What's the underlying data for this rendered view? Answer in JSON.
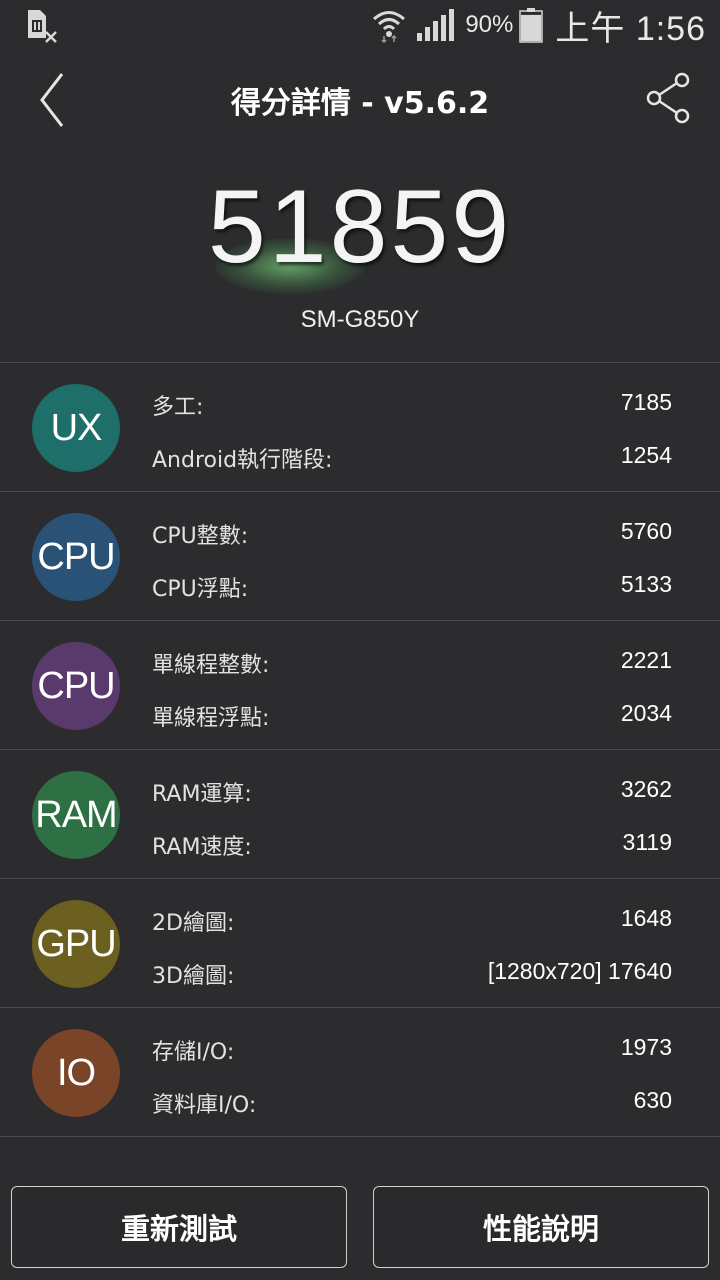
{
  "status_bar": {
    "sim_icon": "no-sim-icon",
    "wifi_icon": "wifi-icon",
    "signal_icon": "signal-icon",
    "battery_percent": "90%",
    "battery_level": 0.9,
    "battery_icon": "battery-icon",
    "time": "上午 1:56"
  },
  "header": {
    "title": "得分詳情 - v5.6.2",
    "back_icon": "back-chevron-icon",
    "share_icon": "share-icon"
  },
  "score": {
    "value": "51859",
    "device": "SM-G850Y"
  },
  "categories": [
    {
      "icon_label": "UX",
      "color": "#1e6f6a",
      "rows": [
        {
          "label": "多工:",
          "value": "7185"
        },
        {
          "label": "Android執行階段:",
          "value": "1254"
        }
      ]
    },
    {
      "icon_label": "CPU",
      "color": "#2a5277",
      "rows": [
        {
          "label": "CPU整數:",
          "value": "5760"
        },
        {
          "label": "CPU浮點:",
          "value": "5133"
        }
      ]
    },
    {
      "icon_label": "CPU",
      "color": "#5a3a6c",
      "rows": [
        {
          "label": "單線程整數:",
          "value": "2221"
        },
        {
          "label": "單線程浮點:",
          "value": "2034"
        }
      ]
    },
    {
      "icon_label": "RAM",
      "color": "#2e7044",
      "rows": [
        {
          "label": "RAM運算:",
          "value": "3262"
        },
        {
          "label": "RAM速度:",
          "value": "3119"
        }
      ]
    },
    {
      "icon_label": "GPU",
      "color": "#6b6020",
      "rows": [
        {
          "label": "2D繪圖:",
          "value": "1648"
        },
        {
          "label": "3D繪圖:",
          "value": "[1280x720] 17640"
        }
      ]
    },
    {
      "icon_label": "IO",
      "color": "#7a4428",
      "rows": [
        {
          "label": "存儲I/O:",
          "value": "1973"
        },
        {
          "label": "資料庫I/O:",
          "value": "630"
        }
      ]
    }
  ],
  "buttons": {
    "retest": "重新測試",
    "info": "性能說明"
  }
}
